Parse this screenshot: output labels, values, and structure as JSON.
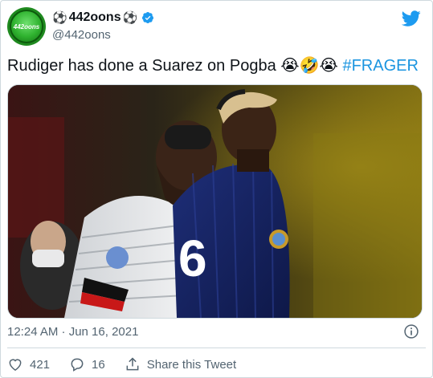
{
  "account": {
    "name": "442oons",
    "name_prefix": "⚽",
    "name_suffix": "⚽",
    "handle": "@442oons",
    "avatar_text": "442oons"
  },
  "tweet": {
    "text": "Rudiger has done a Suarez on Pogba ",
    "emojis": [
      "😭",
      "🤣",
      "😭"
    ],
    "hashtag": "#FRAGER",
    "timestamp": "12:24 AM · Jun 16, 2021",
    "jersey_number": "6"
  },
  "actions": {
    "likes": "421",
    "replies": "16",
    "share_label": "Share this Tweet"
  },
  "icons": {
    "bird": "twitter-bird-icon",
    "verified": "verified-badge-icon",
    "info": "info-icon",
    "like": "heart-icon",
    "reply": "reply-icon",
    "share": "share-icon"
  },
  "colors": {
    "brand": "#1d9bf0",
    "hashtag": "#1b95e0",
    "secondary_text": "#536471",
    "border": "#cfd9de"
  }
}
